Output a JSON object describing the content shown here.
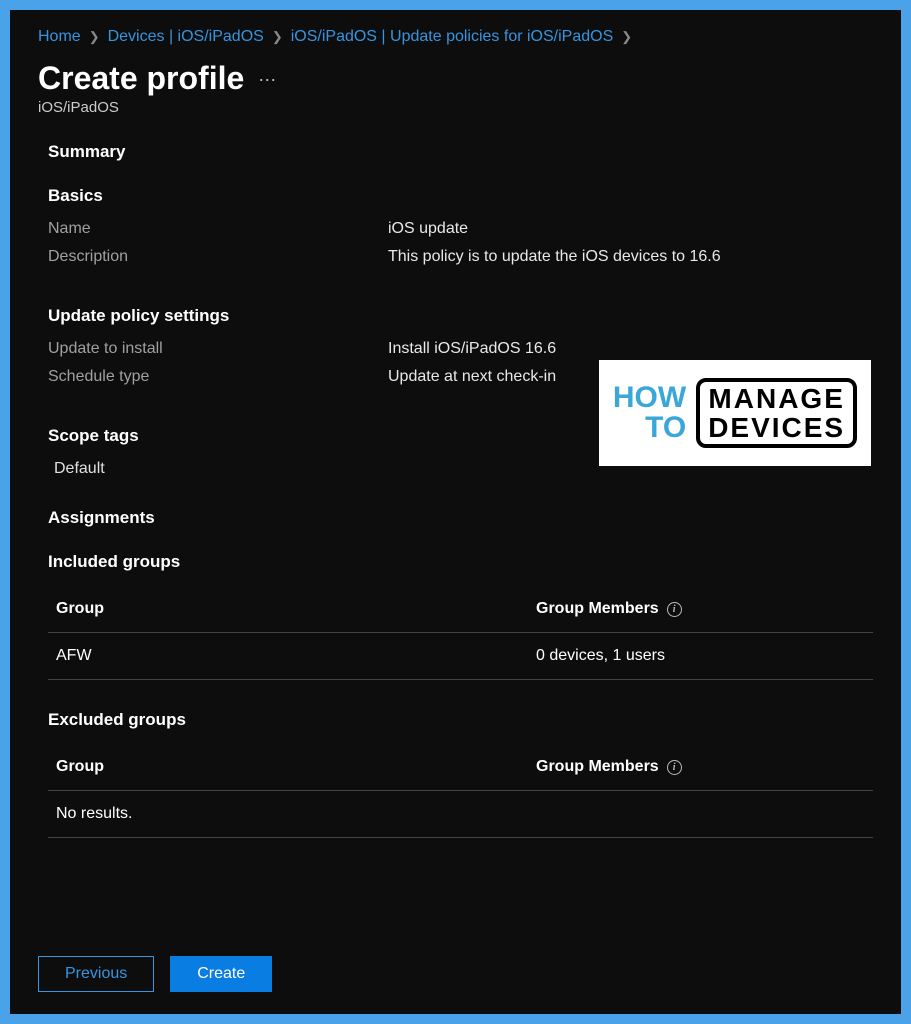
{
  "breadcrumb": {
    "items": [
      {
        "label": "Home"
      },
      {
        "label": "Devices | iOS/iPadOS"
      },
      {
        "label": "iOS/iPadOS | Update policies for iOS/iPadOS"
      }
    ]
  },
  "header": {
    "title": "Create profile",
    "subtitle": "iOS/iPadOS"
  },
  "sections": {
    "summary_label": "Summary",
    "basics": {
      "label": "Basics",
      "name_label": "Name",
      "name_value": "iOS update",
      "desc_label": "Description",
      "desc_value": "This policy is to update the iOS devices to 16.6"
    },
    "update_policy": {
      "label": "Update policy settings",
      "update_label": "Update to install",
      "update_value": "Install iOS/iPadOS 16.6",
      "schedule_label": "Schedule type",
      "schedule_value": "Update at next check-in"
    },
    "scope_tags": {
      "label": "Scope tags",
      "value": "Default"
    },
    "assignments": {
      "label": "Assignments"
    },
    "included_groups": {
      "label": "Included groups",
      "col_group": "Group",
      "col_members": "Group Members",
      "rows": [
        {
          "group": "AFW",
          "members": "0 devices, 1 users"
        }
      ]
    },
    "excluded_groups": {
      "label": "Excluded groups",
      "col_group": "Group",
      "col_members": "Group Members",
      "no_results": "No results."
    }
  },
  "watermark": {
    "left_line1": "HOW",
    "left_line2": "TO",
    "right_line1": "MANAGE",
    "right_line2": "DEVICES"
  },
  "footer": {
    "previous": "Previous",
    "create": "Create"
  }
}
